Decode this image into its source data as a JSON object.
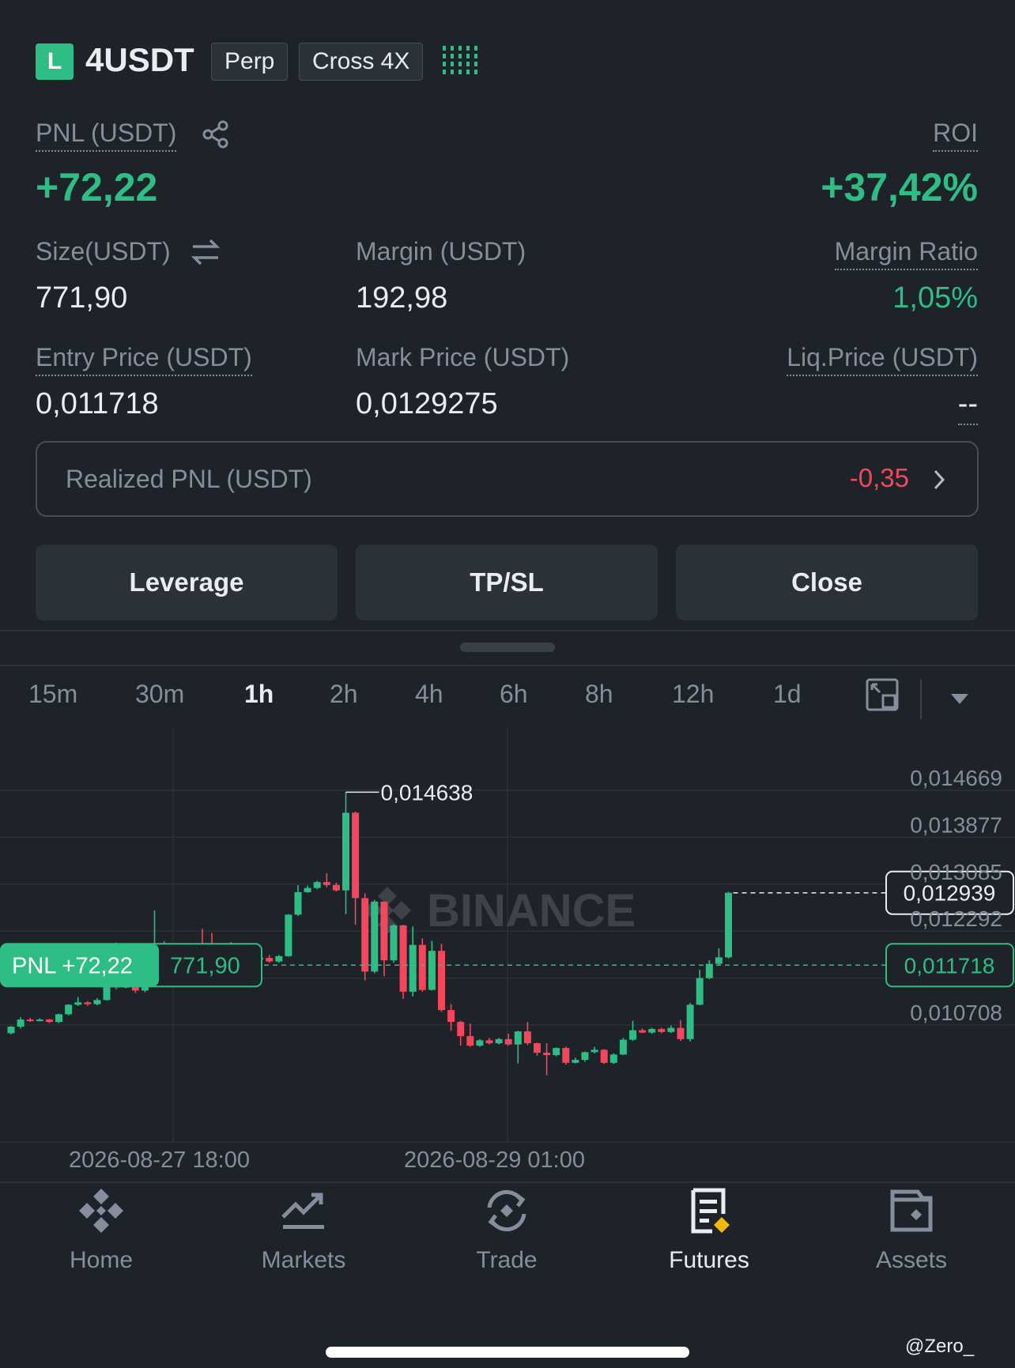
{
  "header": {
    "side_badge": "L",
    "symbol": "4USDT",
    "contract_type": "Perp",
    "margin_mode": "Cross 4X"
  },
  "position": {
    "pnl_label": "PNL (USDT)",
    "pnl_value": "+72,22",
    "roi_label": "ROI",
    "roi_value": "+37,42%",
    "size_label": "Size(USDT)",
    "size_value": "771,90",
    "margin_label": "Margin (USDT)",
    "margin_value": "192,98",
    "margin_ratio_label": "Margin Ratio",
    "margin_ratio_value": "1,05%",
    "entry_price_label": "Entry Price (USDT)",
    "entry_price_value": "0,011718",
    "mark_price_label": "Mark Price (USDT)",
    "mark_price_value": "0,0129275",
    "liq_price_label": "Liq.Price (USDT)",
    "liq_price_value": "--"
  },
  "realized": {
    "label": "Realized PNL (USDT)",
    "value": "-0,35"
  },
  "actions": {
    "leverage": "Leverage",
    "tpsl": "TP/SL",
    "close": "Close"
  },
  "timeframes": [
    "15m",
    "30m",
    "1h",
    "2h",
    "4h",
    "6h",
    "8h",
    "12h",
    "1d"
  ],
  "timeframe_active": "1h",
  "chart": {
    "watermark": "BINANCE",
    "price_axis": [
      "0,014669",
      "0,013877",
      "0,013085",
      "0,012292",
      "0,010708"
    ],
    "time_axis": [
      "2026-08-27 18:00",
      "2026-08-29 01:00"
    ],
    "high_marker": "0,014638",
    "current_price": "0,012939",
    "entry_tag": "0,011718",
    "pnl_tag_label": "PNL +72,22",
    "pnl_tag_size": "771,90",
    "colors": {
      "up": "#2ebd85",
      "down": "#f6465d"
    }
  },
  "chart_data": {
    "type": "candlestick",
    "title": "",
    "xlabel": "",
    "ylabel": "",
    "ylim": [
      0.010708,
      0.014669
    ],
    "candles": [
      [
        0.01057,
        0.01068,
        0.01055,
        0.01069
      ],
      [
        0.01068,
        0.0108,
        0.01065,
        0.01084
      ],
      [
        0.0108,
        0.01079,
        0.01076,
        0.01083
      ],
      [
        0.01079,
        0.0108,
        0.01077,
        0.01082
      ],
      [
        0.0108,
        0.01076,
        0.01074,
        0.01081
      ],
      [
        0.01076,
        0.01089,
        0.01074,
        0.0109
      ],
      [
        0.01089,
        0.01105,
        0.01087,
        0.01106
      ],
      [
        0.01105,
        0.01109,
        0.01103,
        0.01118
      ],
      [
        0.01109,
        0.01106,
        0.01103,
        0.01111
      ],
      [
        0.01106,
        0.01113,
        0.01104,
        0.01116
      ],
      [
        0.01113,
        0.0115,
        0.01112,
        0.01152
      ],
      [
        0.0115,
        0.01134,
        0.01131,
        0.0121
      ],
      [
        0.01134,
        0.01137,
        0.01133,
        0.01142
      ],
      [
        0.01137,
        0.01129,
        0.01125,
        0.01138
      ],
      [
        0.01129,
        0.0114,
        0.01126,
        0.01142
      ],
      [
        0.0114,
        0.01166,
        0.01138,
        0.01264
      ],
      [
        0.01166,
        0.01173,
        0.01162,
        0.01212
      ],
      [
        0.01173,
        0.01187,
        0.0117,
        0.01199
      ],
      [
        0.01187,
        0.01176,
        0.01174,
        0.0119
      ],
      [
        0.01176,
        0.01202,
        0.01174,
        0.01206
      ],
      [
        0.01202,
        0.01195,
        0.0119,
        0.01233
      ],
      [
        0.01195,
        0.01184,
        0.01158,
        0.01226
      ],
      [
        0.01184,
        0.01202,
        0.01182,
        0.01205
      ],
      [
        0.01202,
        0.01188,
        0.01186,
        0.01211
      ],
      [
        0.01188,
        0.01196,
        0.01186,
        0.01204
      ],
      [
        0.01196,
        0.01183,
        0.01181,
        0.01203
      ],
      [
        0.01183,
        0.01184,
        0.01182,
        0.01196
      ],
      [
        0.01184,
        0.01178,
        0.01176,
        0.01189
      ],
      [
        0.01178,
        0.01187,
        0.01176,
        0.01189
      ],
      [
        0.01187,
        0.01257,
        0.01186,
        0.01258
      ],
      [
        0.01257,
        0.01295,
        0.01255,
        0.01307
      ],
      [
        0.01295,
        0.01302,
        0.01294,
        0.01306
      ],
      [
        0.01302,
        0.01312,
        0.013,
        0.01314
      ],
      [
        0.01312,
        0.01307,
        0.01303,
        0.01327
      ],
      [
        0.01307,
        0.01298,
        0.01296,
        0.01311
      ],
      [
        0.01298,
        0.01429,
        0.01258,
        0.014638
      ],
      [
        0.01429,
        0.01285,
        0.0124,
        0.01431
      ],
      [
        0.01285,
        0.01161,
        0.01146,
        0.01293
      ],
      [
        0.01161,
        0.01279,
        0.01158,
        0.01282
      ],
      [
        0.01279,
        0.0118,
        0.01153,
        0.01278
      ],
      [
        0.0118,
        0.01239,
        0.01176,
        0.01241
      ],
      [
        0.01239,
        0.01127,
        0.01115,
        0.0124
      ],
      [
        0.01127,
        0.01206,
        0.01119,
        0.01237
      ],
      [
        0.01206,
        0.0113,
        0.01127,
        0.01217
      ],
      [
        0.0113,
        0.01196,
        0.01129,
        0.01213
      ],
      [
        0.01196,
        0.01096,
        0.01093,
        0.01208
      ],
      [
        0.01096,
        0.01076,
        0.01061,
        0.01106
      ],
      [
        0.01076,
        0.01052,
        0.01036,
        0.01078
      ],
      [
        0.01052,
        0.01036,
        0.01034,
        0.01073
      ],
      [
        0.01036,
        0.01045,
        0.01034,
        0.01047
      ],
      [
        0.01045,
        0.0104,
        0.01038,
        0.01049
      ],
      [
        0.0104,
        0.01047,
        0.01038,
        0.01049
      ],
      [
        0.01047,
        0.01038,
        0.01036,
        0.01056
      ],
      [
        0.01038,
        0.0106,
        0.01006,
        0.01061
      ],
      [
        0.0106,
        0.0104,
        0.01037,
        0.01076
      ],
      [
        0.0104,
        0.01024,
        0.01019,
        0.01041
      ],
      [
        0.01024,
        0.0102,
        0.00986,
        0.0104
      ],
      [
        0.0102,
        0.01032,
        0.01018,
        0.01033
      ],
      [
        0.01032,
        0.01007,
        0.01004,
        0.01034
      ],
      [
        0.01007,
        0.01012,
        0.01006,
        0.01016
      ],
      [
        0.01012,
        0.01025,
        0.01009,
        0.01026
      ],
      [
        0.01025,
        0.01029,
        0.01023,
        0.01034
      ],
      [
        0.01029,
        0.01007,
        0.01005,
        0.0103
      ],
      [
        0.01007,
        0.01021,
        0.01005,
        0.01023
      ],
      [
        0.01021,
        0.01046,
        0.0102,
        0.01049
      ],
      [
        0.01046,
        0.01062,
        0.01044,
        0.01078
      ],
      [
        0.01062,
        0.01058,
        0.01057,
        0.01065
      ],
      [
        0.01058,
        0.01064,
        0.01056,
        0.01066
      ],
      [
        0.01064,
        0.01059,
        0.01057,
        0.01066
      ],
      [
        0.01059,
        0.01066,
        0.01057,
        0.0107
      ],
      [
        0.01066,
        0.01047,
        0.01044,
        0.01079
      ],
      [
        0.01047,
        0.01105,
        0.01043,
        0.01108
      ],
      [
        0.01105,
        0.0115,
        0.01104,
        0.01164
      ],
      [
        0.0115,
        0.01174,
        0.01148,
        0.0118
      ],
      [
        0.01174,
        0.01185,
        0.01172,
        0.012
      ],
      [
        0.01185,
        0.012939,
        0.01183,
        0.01296
      ]
    ],
    "candle_order": "open, close, low, high",
    "reference_lines": [
      {
        "name": "Mark price",
        "value": 0.012939
      },
      {
        "name": "Entry price",
        "value": 0.011718
      }
    ]
  },
  "nav": [
    {
      "label": "Home",
      "icon": "home-icon"
    },
    {
      "label": "Markets",
      "icon": "markets-icon"
    },
    {
      "label": "Trade",
      "icon": "trade-icon"
    },
    {
      "label": "Futures",
      "icon": "futures-icon"
    },
    {
      "label": "Assets",
      "icon": "assets-icon"
    }
  ],
  "nav_active": "Futures",
  "watermark_bottom": "@Zero_"
}
